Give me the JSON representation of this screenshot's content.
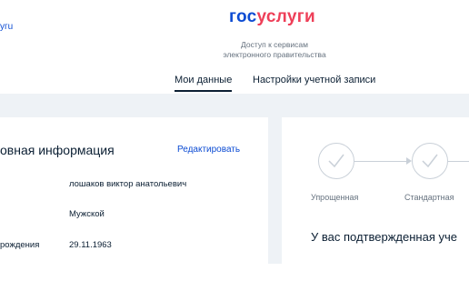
{
  "header": {
    "back_link": "угu",
    "logo_part1": "гос",
    "logo_part2": "услуги",
    "subtitle_line1": "Доступ к сервисам",
    "subtitle_line2": "электронного правительства"
  },
  "tabs": [
    {
      "label": "Мои данные",
      "active": true
    },
    {
      "label": "Настройки учетной записи",
      "active": false
    }
  ],
  "personal_info": {
    "title": "овная информация",
    "edit_label": "Редактировать",
    "rows": [
      {
        "label": "",
        "value": "лошаков виктор анатольевич"
      },
      {
        "label": "",
        "value": "Мужской"
      },
      {
        "label": "рождения",
        "value": "29.11.1963"
      }
    ]
  },
  "account_level": {
    "steps": [
      {
        "label": "Упрощенная",
        "icon": "check-icon"
      },
      {
        "label": "Стандартная",
        "icon": "check-icon"
      }
    ],
    "status_text": "У вас подтвержденная уче"
  },
  "colors": {
    "brand_blue": "#0d4cd3",
    "brand_red": "#ee3f58",
    "page_bg": "#eef2f6",
    "text": "#0b1f33",
    "muted": "#66727f"
  }
}
